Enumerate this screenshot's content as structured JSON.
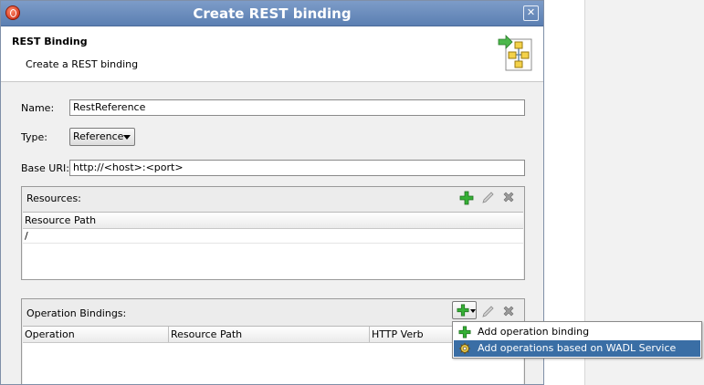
{
  "window": {
    "title": "Create REST binding",
    "close_glyph": "✕"
  },
  "header": {
    "title": "REST Binding",
    "subtitle": "Create a REST binding",
    "icon": "rest-binding-icon"
  },
  "form": {
    "name_label": "Name:",
    "name_value": "RestReference",
    "type_label": "Type:",
    "type_value": "Reference",
    "base_uri_label": "Base URI:",
    "base_uri_value": "http://<host>:<port>"
  },
  "resources": {
    "title": "Resources:",
    "columns": [
      "Resource Path"
    ],
    "rows": [
      "/"
    ]
  },
  "operations": {
    "title": "Operation Bindings:",
    "columns": [
      "Operation",
      "Resource Path",
      "HTTP Verb"
    ]
  },
  "menu": {
    "items": [
      {
        "label": "Add operation binding",
        "icon": "add-icon"
      },
      {
        "label": "Add operations based on WADL Service",
        "icon": "wadl-service-icon",
        "selected": true
      }
    ]
  },
  "colors": {
    "accent": "#3a6ea5",
    "add_green": "#2ea02e",
    "titlebar": "#6b8cbf"
  }
}
